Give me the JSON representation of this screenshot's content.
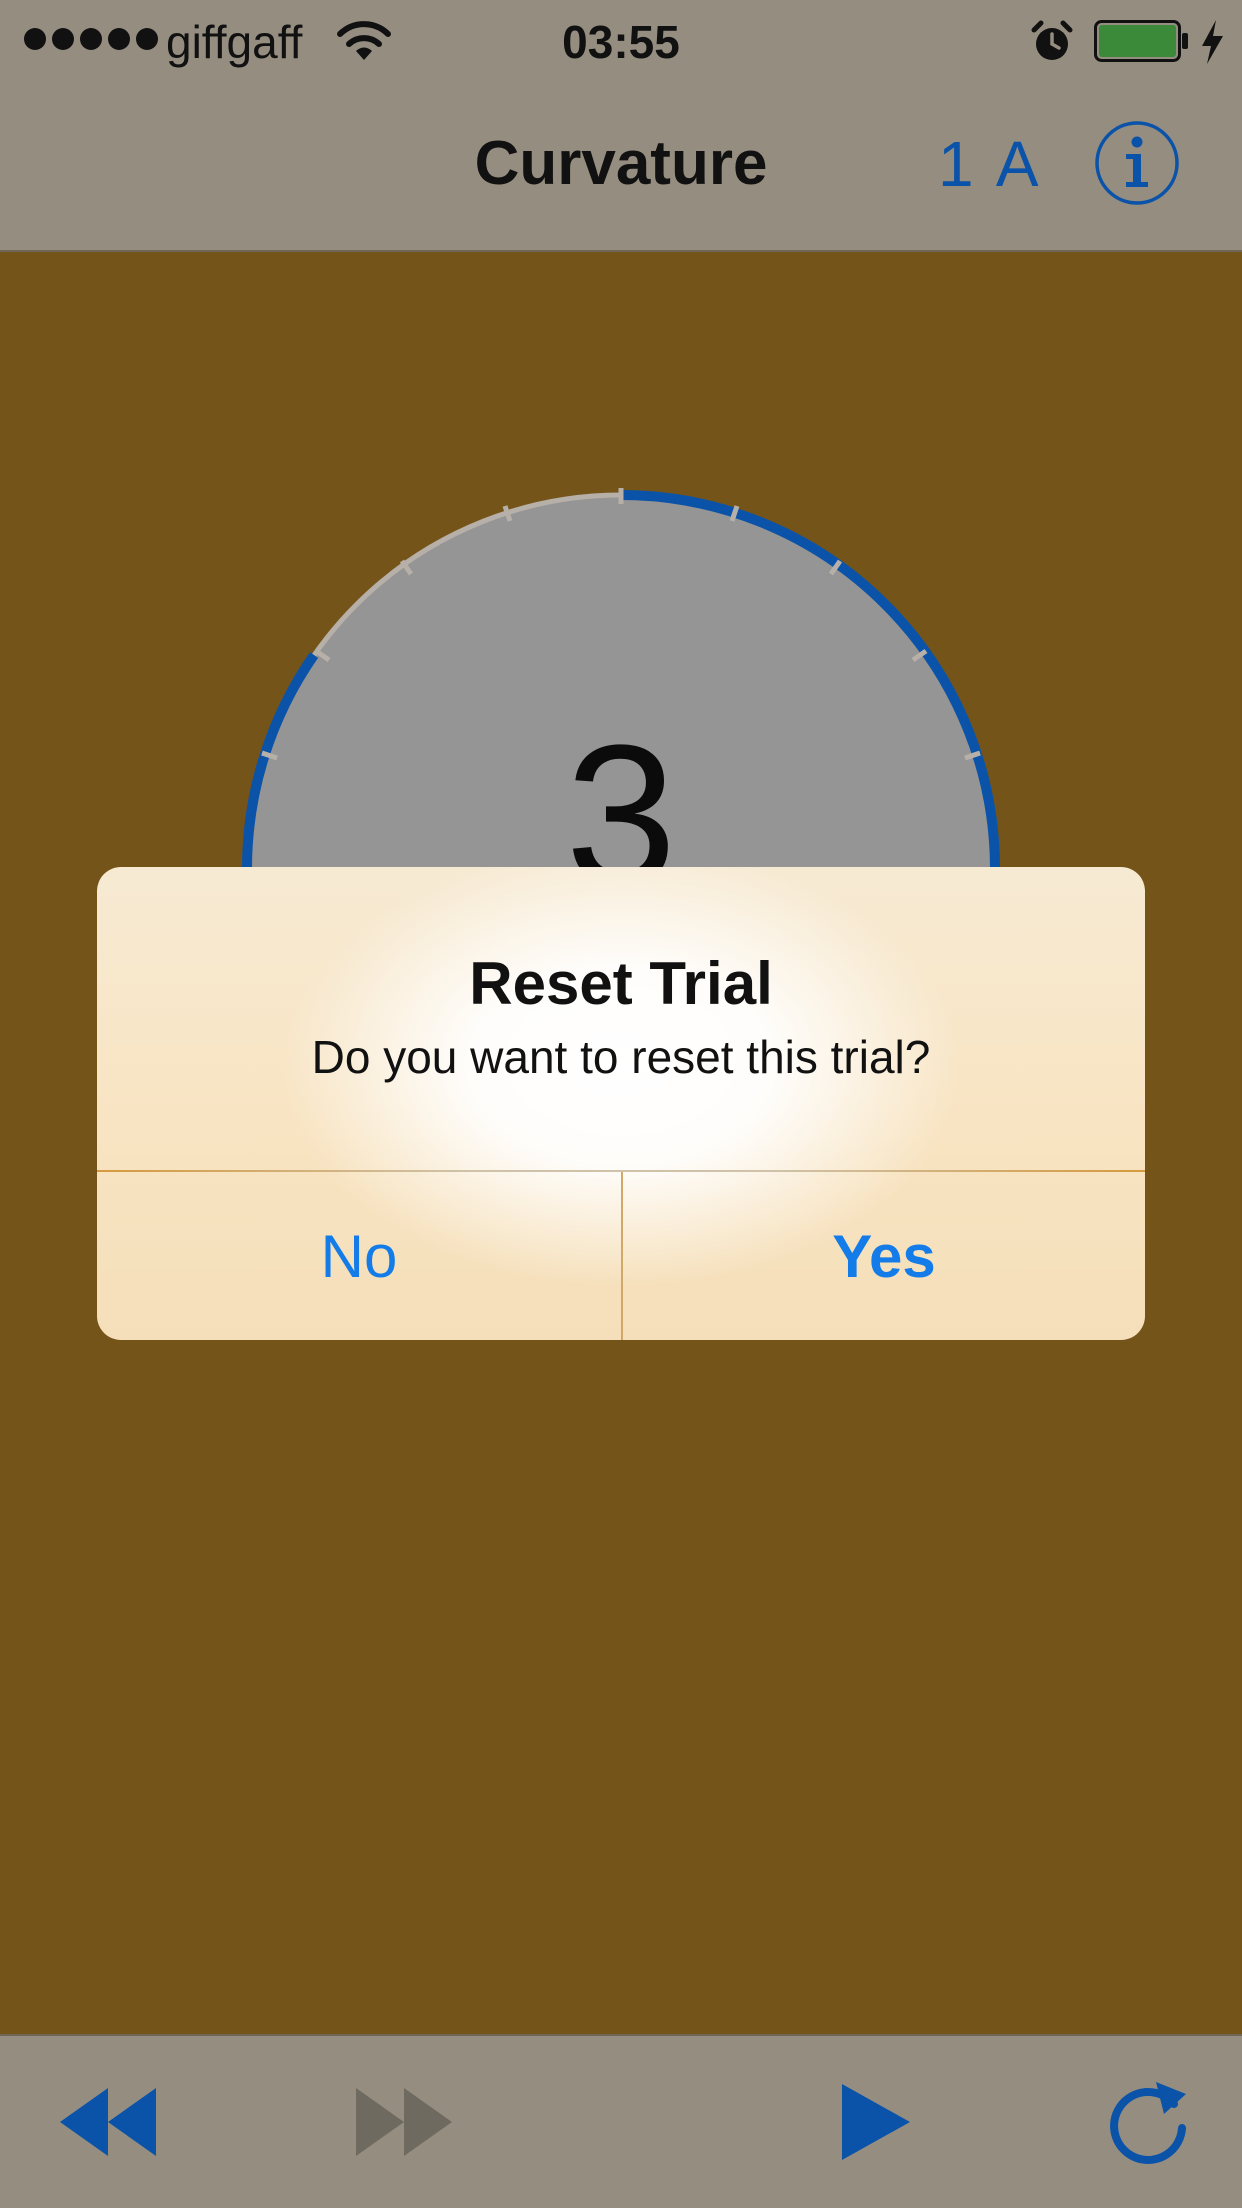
{
  "status_bar": {
    "carrier": "giffgaff",
    "time": "03:55",
    "battery_level": 1.0,
    "battery_color": "#3a8a3a"
  },
  "nav": {
    "title": "Curvature",
    "badge": "1 A",
    "info_icon": "info-icon"
  },
  "dial": {
    "visible_digit": "3",
    "ring_color": "#0a53a8",
    "face_color": "#959595"
  },
  "alert": {
    "title": "Reset Trial",
    "message": "Do you want to reset this trial?",
    "no_label": "No",
    "yes_label": "Yes"
  },
  "toolbar": {
    "rewind_icon": "rewind-icon",
    "forward_icon": "fast-forward-icon",
    "play_icon": "play-icon",
    "reset_icon": "refresh-icon",
    "active_color": "#0a53a8",
    "disabled_color": "#6f6a60"
  },
  "colors": {
    "background": "#75541a",
    "bars": "#958e80"
  }
}
